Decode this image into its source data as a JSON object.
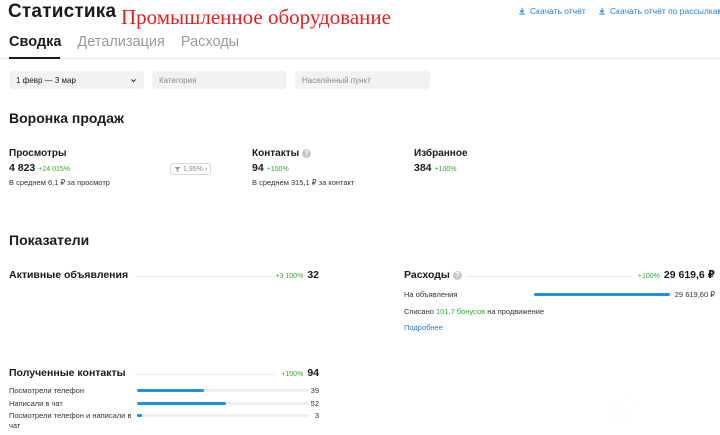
{
  "header": {
    "title": "Статистика",
    "overlay_title": "Промышленное оборудование",
    "download_report": "Скачать отчёт",
    "download_mailing": "Скачать отчёт по рассылкам"
  },
  "tabs": [
    "Сводка",
    "Детализация",
    "Расходы"
  ],
  "filters": {
    "date_range": "1 февр — 3 мар",
    "category_placeholder": "Категория",
    "city_placeholder": "Населённый пункт"
  },
  "funnel": {
    "title": "Воронка продаж",
    "views": {
      "label": "Просмотры",
      "value": "4 823",
      "delta": "+24 015%",
      "sub": "В среднем 6,1 ₽ за просмотр"
    },
    "conversion": "1,95%",
    "contacts": {
      "label": "Контакты",
      "value": "94",
      "delta": "+100%",
      "sub": "В среднем 315,1 ₽ за контакт"
    },
    "favorites": {
      "label": "Избранное",
      "value": "384",
      "delta": "+100%"
    }
  },
  "indicators": {
    "title": "Показатели",
    "active_ads": {
      "label": "Активные объявления",
      "delta": "+3 100%",
      "value": "32"
    },
    "expenses": {
      "label": "Расходы",
      "delta": "+100%",
      "value": "29 619,6 ₽",
      "row_label": "На объявления",
      "row_value": "29 619,60 ₽",
      "row_fraction": 1.0,
      "bonus_prefix": "Списано",
      "bonus_amount": "101,7 бонусов",
      "bonus_suffix": "на продвижение",
      "details_link": "Подробнее"
    },
    "received_contacts": {
      "label": "Полученные контакты",
      "delta": "+100%",
      "value": "94",
      "rows": [
        {
          "label": "Посмотрели телефон",
          "value": "39",
          "fraction": 0.39
        },
        {
          "label": "Написали в чат",
          "value": "52",
          "fraction": 0.52
        },
        {
          "label": "Посмотрели телефон и написали в чат",
          "value": "3",
          "fraction": 0.03
        }
      ]
    }
  },
  "watermark": "Avito"
}
